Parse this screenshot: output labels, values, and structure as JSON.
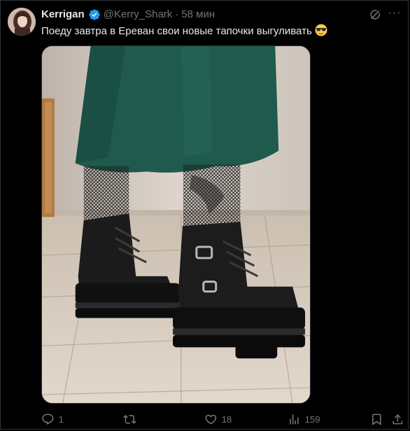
{
  "tweet": {
    "author_name": "Kerrigan",
    "handle": "@Kerry_Shark",
    "separator": "·",
    "time": "58 мин",
    "text": "Поеду завтра в Ереван свои новые тапочки выгуливать",
    "emoji_icon": "sunglasses-face-emoji"
  },
  "metrics": {
    "replies": "1",
    "retweets": "",
    "likes": "18",
    "views": "159"
  },
  "colors": {
    "background": "#000000",
    "text": "#e7e9ea",
    "muted": "#71767b",
    "verified": "#1d9bf0",
    "border": "#2f3336"
  }
}
